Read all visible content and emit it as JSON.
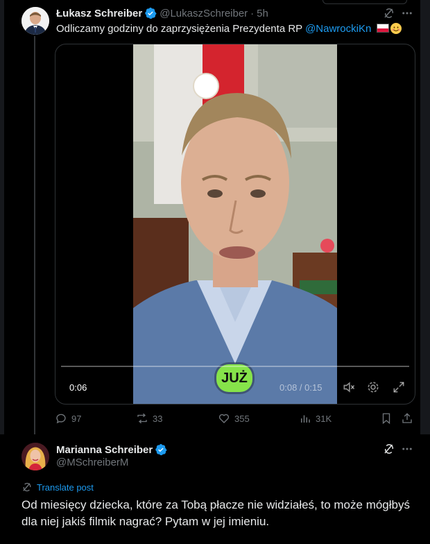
{
  "tweet": {
    "author_name": "Łukasz Schreiber",
    "author_handle": "@LukaszSchreiber",
    "separator": "·",
    "time_ago": "5h",
    "text": "Odliczamy godziny do zaprzysiężenia Prezydenta RP ",
    "mention": "@NawrockiKn",
    "video": {
      "overlay_label": "JUŻ",
      "elapsed": "0:06",
      "position_duration": "0:08 / 0:15",
      "progress_fraction": 0.53
    },
    "stats": {
      "replies": "97",
      "reposts": "33",
      "likes": "355",
      "views": "31K"
    }
  },
  "reply": {
    "author_name": "Marianna Schreiber",
    "author_handle": "@MSchreiberM",
    "translate_label": "Translate post",
    "text": "Od miesięcy dziecka, które za Tobą płacze nie widziałeś, to może mógłbyś dla niej jakiś filmik nagrać? Pytam w jej imieniu."
  },
  "colors": {
    "background": "#000000",
    "text": "#e7e9ea",
    "muted": "#71767b",
    "accent": "#1d9bf0",
    "badge": "#86e34a"
  },
  "icons": [
    "verified-badge-icon",
    "grok-icon",
    "more-icon",
    "reply-icon",
    "repost-icon",
    "like-icon",
    "views-icon",
    "bookmark-icon",
    "share-icon",
    "mute-icon",
    "settings-icon",
    "fullscreen-icon",
    "translate-icon"
  ]
}
